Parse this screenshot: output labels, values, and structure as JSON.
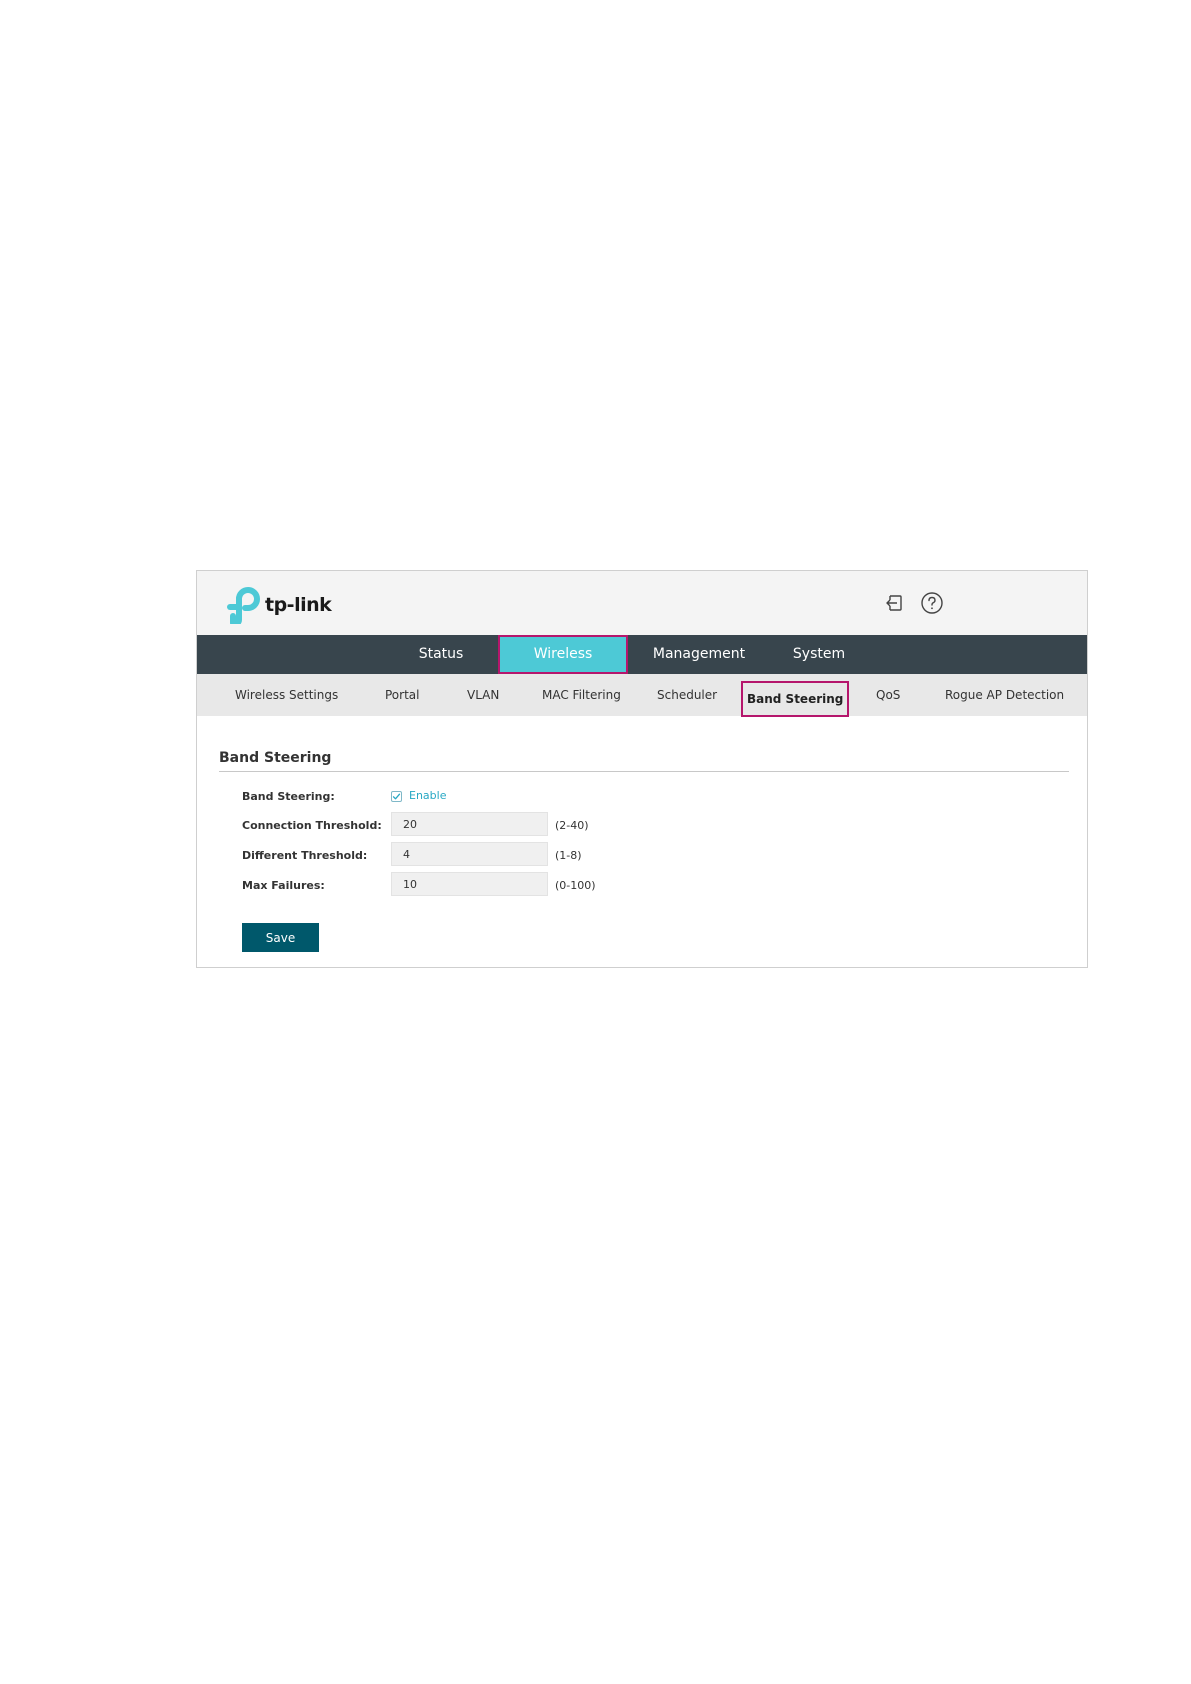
{
  "brand": {
    "logo_text": "tp-link",
    "accent_color": "#4dc9d6",
    "nav_bg_color": "#38454d",
    "highlight_color": "#b5166c"
  },
  "top_icons": [
    "logout-icon",
    "help-icon"
  ],
  "main_nav": {
    "items": [
      {
        "label": "Status"
      },
      {
        "label": "Wireless",
        "active": true
      },
      {
        "label": "Management"
      },
      {
        "label": "System"
      }
    ]
  },
  "sub_nav": {
    "items": [
      {
        "label": "Wireless Settings"
      },
      {
        "label": "Portal"
      },
      {
        "label": "VLAN"
      },
      {
        "label": "MAC Filtering"
      },
      {
        "label": "Scheduler"
      },
      {
        "label": "Band Steering",
        "active": true
      },
      {
        "label": "QoS"
      },
      {
        "label": "Rogue AP Detection"
      }
    ]
  },
  "section": {
    "title": "Band Steering"
  },
  "form": {
    "band_steering": {
      "label": "Band Steering:",
      "enabled": true,
      "checkbox_label": "Enable"
    },
    "connection_threshold": {
      "label": "Connection Threshold:",
      "value": "20",
      "range": "(2-40)"
    },
    "different_threshold": {
      "label": "Different Threshold:",
      "value": "4",
      "range": "(1-8)"
    },
    "max_failures": {
      "label": "Max Failures:",
      "value": "10",
      "range": "(0-100)"
    },
    "save_label": "Save"
  }
}
